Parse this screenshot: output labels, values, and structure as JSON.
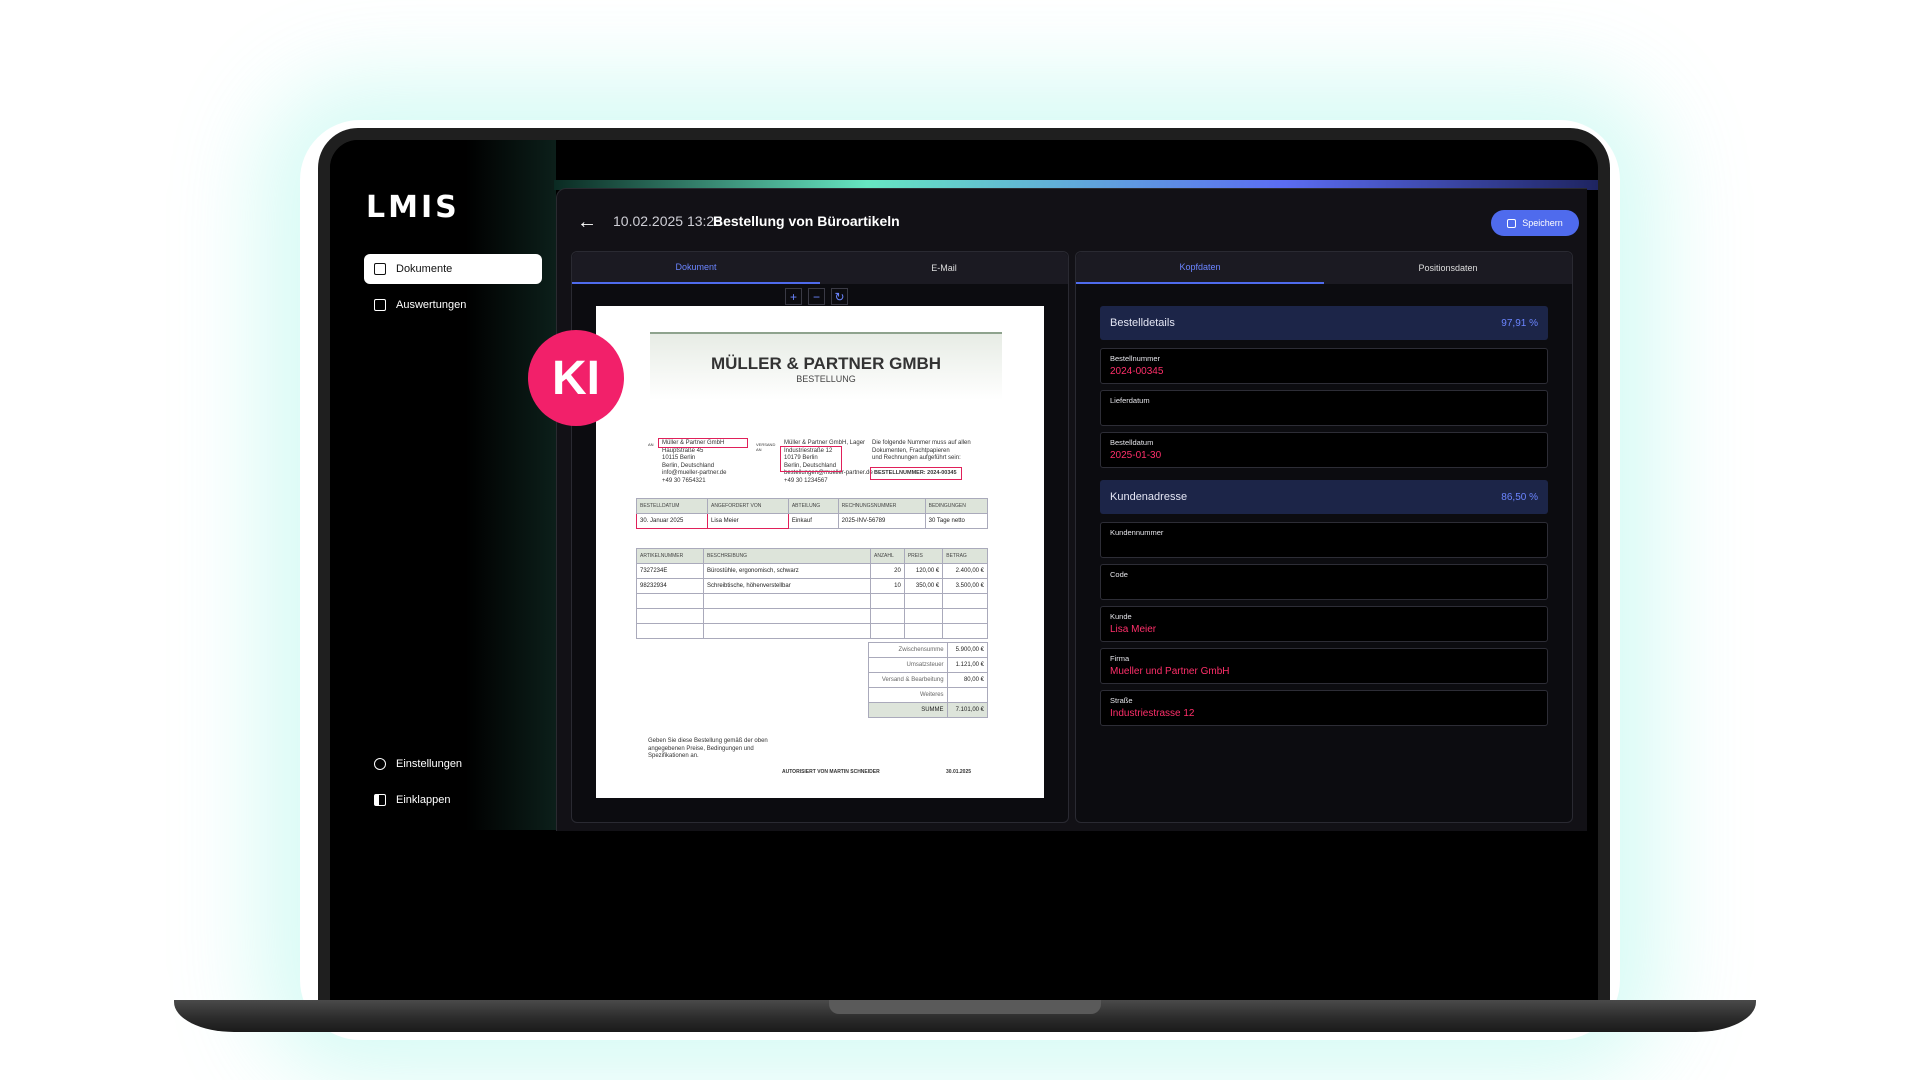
{
  "app": {
    "logo": "LMIS"
  },
  "sidebar": {
    "items": [
      {
        "label": "Dokumente",
        "icon": "document-icon"
      },
      {
        "label": "Auswertungen",
        "icon": "chart-icon"
      }
    ],
    "bottom": [
      {
        "label": "Einstellungen",
        "icon": "gear-icon"
      },
      {
        "label": "Einklappen",
        "icon": "collapse-icon"
      }
    ]
  },
  "header": {
    "datetime": "10.02.2025 13:25",
    "title": "Bestellung von Büroartikeln",
    "save_label": "Speichern"
  },
  "doc_tabs": [
    "Dokument",
    "E-Mail"
  ],
  "data_tabs": [
    "Kopfdaten",
    "Positionsdaten"
  ],
  "badge": "KI",
  "document": {
    "company": "MÜLLER & PARTNER GMBH",
    "subtitle": "BESTELLUNG",
    "an_label": "AN",
    "an_address": "Müller & Partner GmbH\nHauptstraße 45\n10115 Berlin\nBerlin, Deutschland\ninfo@mueller-partner.de\n+49 30 7654321",
    "versand_label": "VERSAND AN",
    "versand_address": "Müller & Partner GmbH, Lager\nIndustriestraße 12\n10179 Berlin\nBerlin, Deutschland\nbestellungen@mueller-partner.de\n+49 30 1234567",
    "note": "Die folgende Nummer muss auf allen\nDokumenten, Frachtpapieren\nund Rechnungen aufgeführt sein:",
    "order_number": "BESTELLNUMMER: 2024-00345",
    "info_headers": [
      "BESTELLDATUM",
      "ANGEFORDERT VON",
      "ABTEILUNG",
      "RECHNUNGSNUMMER",
      "BEDINGUNGEN"
    ],
    "info_values": [
      "30. Januar 2025",
      "Lisa Meier",
      "Einkauf",
      "2025-INV-56789",
      "30 Tage netto"
    ],
    "item_headers": [
      "ARTIKELNUMMER",
      "BESCHREIBUNG",
      "ANZAHL",
      "PREIS",
      "BETRAG"
    ],
    "items": [
      [
        "7327234E",
        "Bürostühle, ergonomisch, schwarz",
        "20",
        "120,00 €",
        "2.400,00 €"
      ],
      [
        "98232934",
        "Schreibtische, höhenverstellbar",
        "10",
        "350,00 €",
        "3.500,00 €"
      ]
    ],
    "totals": [
      [
        "Zwischensumme",
        "5.900,00 €"
      ],
      [
        "Umsatzsteuer",
        "1.121,00 €"
      ],
      [
        "Versand & Bearbeitung",
        "80,00 €"
      ],
      [
        "Weiteres",
        ""
      ],
      [
        "SUMME",
        "7.101,00 €"
      ]
    ],
    "footer_note": "Geben Sie diese Bestellung gemäß der oben\nangegebenen Preise, Bedingungen und\nSpezifikationen an.",
    "authorized": "AUTORISIERT VON MARTIN SCHNEIDER",
    "auth_date": "30.01.2025"
  },
  "sections": [
    {
      "label": "Bestelldetails",
      "pct": "97,91 %"
    },
    {
      "label": "Kundenadresse",
      "pct": "86,50 %"
    }
  ],
  "fields": [
    {
      "label": "Bestellnummer",
      "value": "2024-00345"
    },
    {
      "label": "Lieferdatum",
      "value": ""
    },
    {
      "label": "Bestelldatum",
      "value": "2025-01-30"
    },
    {
      "label": "Kundennummer",
      "value": ""
    },
    {
      "label": "Code",
      "value": ""
    },
    {
      "label": "Kunde",
      "value": "Lisa Meier"
    },
    {
      "label": "Firma",
      "value": "Mueller und Partner GmbH"
    },
    {
      "label": "Straße",
      "value": "Industriestrasse 12"
    }
  ]
}
